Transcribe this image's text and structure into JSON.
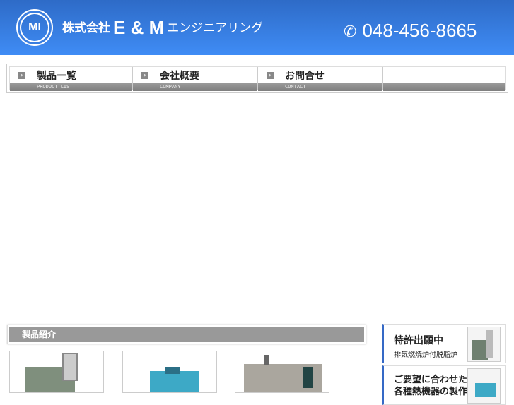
{
  "header": {
    "logo_text": "MI",
    "company_prefix": "株式会社",
    "company_name": "E & M",
    "company_suffix": "エンジニアリング",
    "phone_icon": "phone-icon",
    "phone": "048-456-8665"
  },
  "nav": [
    {
      "label": "製品一覧",
      "sub": "PRODUCT LIST"
    },
    {
      "label": "会社概要",
      "sub": "COMPANY"
    },
    {
      "label": "お問合せ",
      "sub": "CONTACT"
    }
  ],
  "products": {
    "title": "製品紹介"
  },
  "banners": [
    {
      "title": "特許出願中",
      "subtitle": "排気燃焼炉付脱脂炉"
    },
    {
      "title": "ご要望に合わせた",
      "subtitle": "各種熱機器の製作"
    }
  ]
}
